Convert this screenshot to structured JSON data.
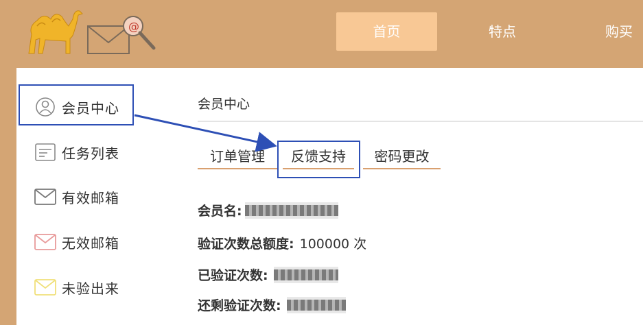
{
  "header": {
    "nav": {
      "home": "首页",
      "features": "特点",
      "buy": "购买"
    }
  },
  "sidebar": {
    "items": [
      {
        "label": "会员中心",
        "icon": "user-circle-icon"
      },
      {
        "label": "任务列表",
        "icon": "task-list-icon"
      },
      {
        "label": "有效邮箱",
        "icon": "envelope-valid-icon"
      },
      {
        "label": "无效邮箱",
        "icon": "envelope-invalid-icon"
      },
      {
        "label": "未验出来",
        "icon": "envelope-unverified-icon"
      }
    ]
  },
  "main": {
    "title": "会员中心",
    "tabs": [
      {
        "label": "订单管理"
      },
      {
        "label": "反馈支持"
      },
      {
        "label": "密码更改"
      }
    ],
    "info": {
      "member_name_label": "会员名:",
      "quota_label": "验证次数总额度:",
      "quota_value": "100000 次",
      "used_label": "已验证次数:",
      "remaining_label": "还剩验证次数:"
    }
  },
  "colors": {
    "background": "#d4a574",
    "nav_active": "#f8c895",
    "highlight_box": "#2d4fb5",
    "tab_underline": "#d9a06f"
  }
}
